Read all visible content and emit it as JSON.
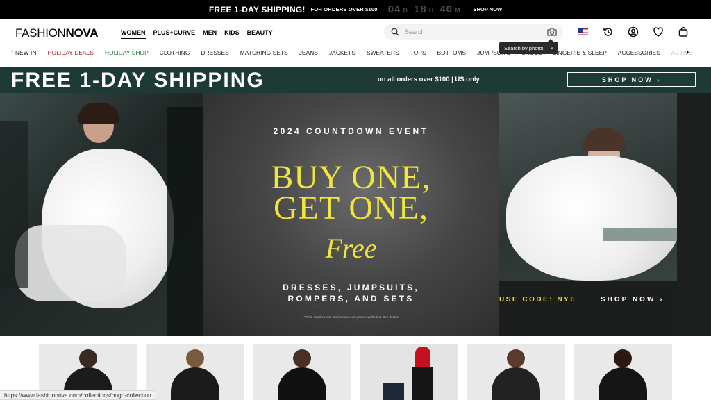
{
  "topbar": {
    "headline": "FREE 1-DAY SHIPPING!",
    "subtext": "FOR ORDERS OVER $100",
    "timer": {
      "days": "04",
      "hours": "18",
      "minutes": "40"
    },
    "link": "SHOP NOW"
  },
  "header": {
    "logo_light": "FASHION",
    "logo_bold": "NOVA",
    "nav": [
      "WOMEN",
      "PLUS+CURVE",
      "MEN",
      "KIDS",
      "BEAUTY"
    ],
    "active_nav": "WOMEN",
    "search_placeholder": "Search",
    "tooltip": "Search by photo!",
    "tooltip_close": "×"
  },
  "categories": [
    {
      "label": "NEW IN",
      "style": "normal"
    },
    {
      "label": "HOLIDAY DEALS",
      "style": "red"
    },
    {
      "label": "HOLIDAY SHOP",
      "style": "green"
    },
    {
      "label": "CLOTHING",
      "style": "normal"
    },
    {
      "label": "DRESSES",
      "style": "normal"
    },
    {
      "label": "MATCHING SETS",
      "style": "normal"
    },
    {
      "label": "JEANS",
      "style": "normal"
    },
    {
      "label": "JACKETS",
      "style": "normal"
    },
    {
      "label": "SWEATERS",
      "style": "normal"
    },
    {
      "label": "TOPS",
      "style": "normal"
    },
    {
      "label": "BOTTOMS",
      "style": "normal"
    },
    {
      "label": "JUMPSUITS",
      "style": "normal"
    },
    {
      "label": "SHOES",
      "style": "normal"
    },
    {
      "label": "LINGERIE & SLEEP",
      "style": "normal"
    },
    {
      "label": "ACCESSORIES",
      "style": "normal"
    },
    {
      "label": "ACTIVE",
      "style": "fade"
    }
  ],
  "promo": {
    "title": "FREE 1-DAY SHIPPING",
    "subtitle": "on all orders over $100 | US only",
    "button": "SHOP NOW ›"
  },
  "hero": {
    "event": "2024 COUNTDOWN EVENT",
    "line1": "BUY ONE,",
    "line2": "GET ONE,",
    "line3": "Free",
    "categories_line1": "DRESSES, JUMPSUITS,",
    "categories_line2": "ROMPERS, AND SETS",
    "fine_print": "*While supplies last. fashionnova.com promo. While last. See details",
    "code": "USE CODE: NYE",
    "shop": "SHOP NOW ›"
  },
  "status_url": "https://www.fashionnova.com/collections/bogo-collection",
  "colors": {
    "promo_bg": "#1e3a36",
    "accent_yellow": "#f0e63c",
    "deal_red": "#b0191e",
    "holiday_green": "#1c7a2f"
  }
}
